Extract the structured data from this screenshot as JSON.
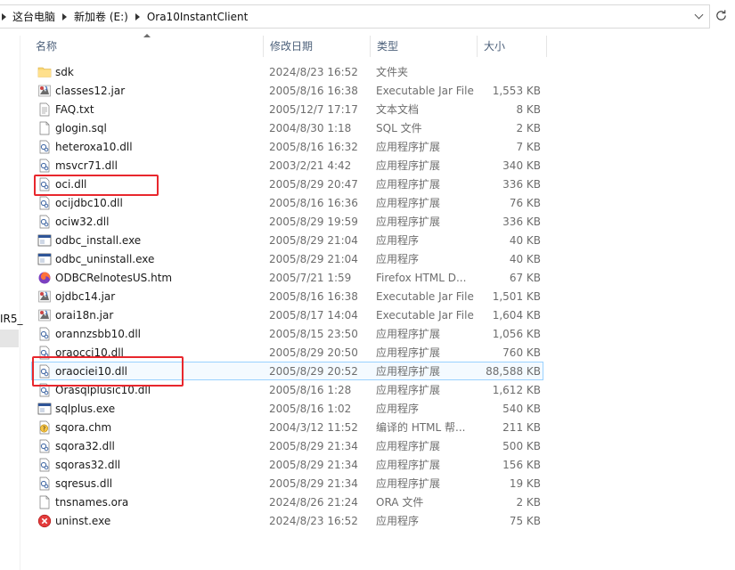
{
  "address_bar": {
    "crumbs": [
      "这台电脑",
      "新加卷 (E:)",
      "Ora10InstantClient"
    ]
  },
  "left_pane": {
    "fragment_text": "IR5_"
  },
  "columns": {
    "name": "名称",
    "date": "修改日期",
    "type": "类型",
    "size": "大小"
  },
  "files": [
    {
      "name": "sdk",
      "date": "2024/8/23 16:52",
      "type": "文件夹",
      "size": "",
      "icon": "folder-icon"
    },
    {
      "name": "classes12.jar",
      "date": "2005/8/16 16:38",
      "type": "Executable Jar File",
      "size": "1,553 KB",
      "icon": "jar-icon"
    },
    {
      "name": "FAQ.txt",
      "date": "2005/12/7 17:17",
      "type": "文本文档",
      "size": "8 KB",
      "icon": "text-file-icon"
    },
    {
      "name": "glogin.sql",
      "date": "2004/8/30 1:18",
      "type": "SQL 文件",
      "size": "2 KB",
      "icon": "blank-file-icon"
    },
    {
      "name": "heteroxa10.dll",
      "date": "2005/8/16 16:32",
      "type": "应用程序扩展",
      "size": "7 KB",
      "icon": "dll-icon"
    },
    {
      "name": "msvcr71.dll",
      "date": "2003/2/21 4:42",
      "type": "应用程序扩展",
      "size": "340 KB",
      "icon": "dll-icon"
    },
    {
      "name": "oci.dll",
      "date": "2005/8/29 20:47",
      "type": "应用程序扩展",
      "size": "336 KB",
      "icon": "dll-icon"
    },
    {
      "name": "ocijdbc10.dll",
      "date": "2005/8/16 16:36",
      "type": "应用程序扩展",
      "size": "76 KB",
      "icon": "dll-icon"
    },
    {
      "name": "ociw32.dll",
      "date": "2005/8/29 19:59",
      "type": "应用程序扩展",
      "size": "336 KB",
      "icon": "dll-icon"
    },
    {
      "name": "odbc_install.exe",
      "date": "2005/8/29 21:04",
      "type": "应用程序",
      "size": "40 KB",
      "icon": "exe-icon"
    },
    {
      "name": "odbc_uninstall.exe",
      "date": "2005/8/29 21:04",
      "type": "应用程序",
      "size": "40 KB",
      "icon": "exe-icon"
    },
    {
      "name": "ODBCRelnotesUS.htm",
      "date": "2005/7/21 1:59",
      "type": "Firefox HTML D...",
      "size": "67 KB",
      "icon": "firefox-html-icon"
    },
    {
      "name": "ojdbc14.jar",
      "date": "2005/8/16 16:38",
      "type": "Executable Jar File",
      "size": "1,501 KB",
      "icon": "jar-icon"
    },
    {
      "name": "orai18n.jar",
      "date": "2005/8/17 14:04",
      "type": "Executable Jar File",
      "size": "1,604 KB",
      "icon": "jar-icon"
    },
    {
      "name": "orannzsbb10.dll",
      "date": "2005/8/15 23:50",
      "type": "应用程序扩展",
      "size": "1,056 KB",
      "icon": "dll-icon"
    },
    {
      "name": "oraocci10.dll",
      "date": "2005/8/29 20:50",
      "type": "应用程序扩展",
      "size": "760 KB",
      "icon": "dll-icon"
    },
    {
      "name": "oraociei10.dll",
      "date": "2005/8/29 20:52",
      "type": "应用程序扩展",
      "size": "88,588 KB",
      "icon": "dll-icon"
    },
    {
      "name": "Orasqlplusic10.dll",
      "date": "2005/8/16 1:28",
      "type": "应用程序扩展",
      "size": "1,612 KB",
      "icon": "dll-icon"
    },
    {
      "name": "sqlplus.exe",
      "date": "2005/8/16 1:02",
      "type": "应用程序",
      "size": "540 KB",
      "icon": "exe-icon"
    },
    {
      "name": "sqora.chm",
      "date": "2004/3/12 11:52",
      "type": "编译的 HTML 帮...",
      "size": "211 KB",
      "icon": "chm-help-icon"
    },
    {
      "name": "sqora32.dll",
      "date": "2005/8/29 21:34",
      "type": "应用程序扩展",
      "size": "500 KB",
      "icon": "dll-icon"
    },
    {
      "name": "sqoras32.dll",
      "date": "2005/8/29 21:34",
      "type": "应用程序扩展",
      "size": "156 KB",
      "icon": "dll-icon"
    },
    {
      "name": "sqresus.dll",
      "date": "2005/8/29 21:34",
      "type": "应用程序扩展",
      "size": "19 KB",
      "icon": "dll-icon"
    },
    {
      "name": "tnsnames.ora",
      "date": "2024/8/26 21:24",
      "type": "ORA 文件",
      "size": "2 KB",
      "icon": "blank-file-icon"
    },
    {
      "name": "uninst.exe",
      "date": "2024/8/23 16:52",
      "type": "应用程序",
      "size": "75 KB",
      "icon": "uninstall-icon"
    }
  ],
  "selected_row": "oraociei10.dll",
  "colors": {
    "header_text": "#4c607a",
    "secondary_text": "#6d6d6d",
    "annotation": "#e8272d",
    "selection_border": "#99d1ff"
  }
}
